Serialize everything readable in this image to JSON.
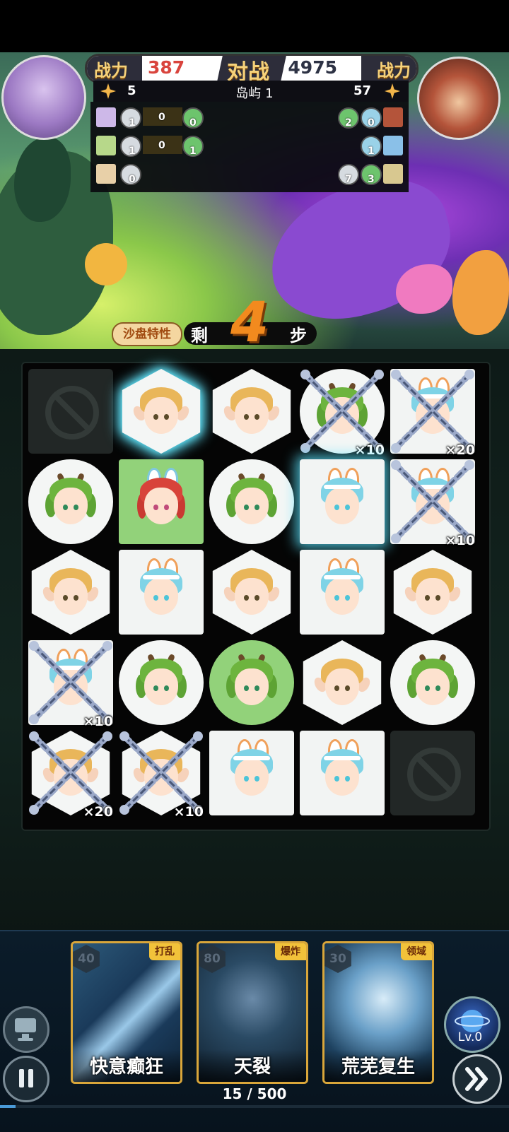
{
  "header": {
    "power_left_label": "战力",
    "power_left_value": "387",
    "vs_label": "对战",
    "power_right_value": "4975",
    "power_right_label": "战力",
    "stars_left": "5",
    "stage_name": "岛屿 1",
    "stars_right": "57"
  },
  "team_panel": {
    "left_rows": [
      {
        "token": "1",
        "count": "0",
        "token2": "0"
      },
      {
        "token": "1",
        "count": "0",
        "token2": "1"
      },
      {
        "token": "0"
      }
    ],
    "right_rows": [
      {
        "token": "2",
        "token2": "0"
      },
      {
        "token": "1"
      },
      {
        "token": "7",
        "token2": "3"
      }
    ]
  },
  "steps": {
    "badge": "沙盘特性",
    "prefix": "剩",
    "number": "4",
    "suffix": "步"
  },
  "board": {
    "rows": [
      [
        {
          "type": "blocked"
        },
        {
          "type": "blonde",
          "shape": "hex",
          "glow": true
        },
        {
          "type": "blonde",
          "shape": "hex"
        },
        {
          "type": "greenhair",
          "shape": "circ",
          "lock": "×10"
        },
        {
          "type": "bunny",
          "shape": "sq",
          "lock": "×20"
        }
      ],
      [
        {
          "type": "greenhair",
          "shape": "circ"
        },
        {
          "type": "redhair",
          "shape": "sq",
          "green": true
        },
        {
          "type": "greenhair",
          "shape": "circ"
        },
        {
          "type": "bunny",
          "shape": "sq",
          "glow": true
        },
        {
          "type": "bunny",
          "shape": "sq",
          "lock": "×10"
        }
      ],
      [
        {
          "type": "blonde",
          "shape": "hex"
        },
        {
          "type": "bunny",
          "shape": "sq"
        },
        {
          "type": "blonde",
          "shape": "hex"
        },
        {
          "type": "bunny",
          "shape": "sq"
        },
        {
          "type": "blonde",
          "shape": "hex"
        }
      ],
      [
        {
          "type": "bunny",
          "shape": "sq",
          "lock": "×10"
        },
        {
          "type": "greenhair",
          "shape": "circ"
        },
        {
          "type": "greenhair",
          "shape": "circ",
          "green": true
        },
        {
          "type": "blonde",
          "shape": "hex"
        },
        {
          "type": "greenhair",
          "shape": "circ"
        }
      ],
      [
        {
          "type": "blonde",
          "shape": "hex",
          "lock": "×20"
        },
        {
          "type": "blonde",
          "shape": "hex",
          "lock": "×10"
        },
        {
          "type": "bunny",
          "shape": "sq"
        },
        {
          "type": "bunny",
          "shape": "sq"
        },
        {
          "type": "blocked"
        }
      ]
    ]
  },
  "skills": [
    {
      "cost": "40",
      "tag": "打乱",
      "name": "快意癫狂"
    },
    {
      "cost": "80",
      "tag": "爆炸",
      "name": "天裂"
    },
    {
      "cost": "30",
      "tag": "领域",
      "name": "荒芜复生"
    }
  ],
  "level": "Lv.0",
  "progress": {
    "text": "15 / 500",
    "current": 15,
    "total": 500
  },
  "colors": {
    "accent_gold": "#d9a63a",
    "power_left": "#d9443d",
    "steps_orange": "#f28a1e",
    "glow_cyan": "#62e8ff"
  }
}
